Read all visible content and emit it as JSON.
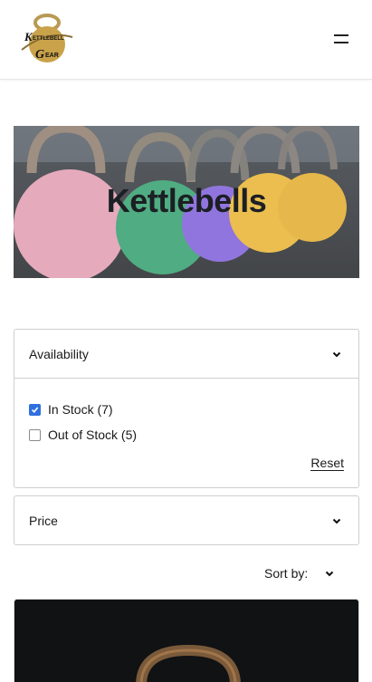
{
  "header": {
    "logo_text": "Kettlebell Gear",
    "menu_icon": "hamburger-icon"
  },
  "hero": {
    "title": "Kettlebells"
  },
  "filters": {
    "availability": {
      "label": "Availability",
      "options": [
        {
          "label": "In Stock (7)",
          "checked": true
        },
        {
          "label": "Out of Stock (5)",
          "checked": false
        }
      ],
      "reset_label": "Reset"
    },
    "price": {
      "label": "Price"
    }
  },
  "sort": {
    "label": "Sort by:"
  },
  "colors": {
    "accent": "#2f6fde",
    "logo_gold": "#c9a24a"
  }
}
